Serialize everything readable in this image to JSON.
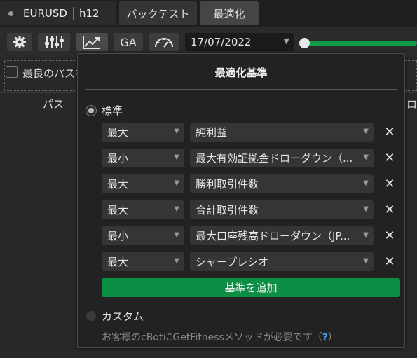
{
  "tabs": {
    "symbol": "EURUSD",
    "timeframe": "h12",
    "backtest": "バックテスト",
    "optimize": "最適化"
  },
  "toolbar": {
    "icons": [
      "gear-icon",
      "sliders-icon",
      "chart-line-icon",
      "ga-icon",
      "gauge-icon"
    ],
    "ga_label": "GA",
    "date": "17/07/2022",
    "progress": 1.0,
    "progress_color": "#0e9a44"
  },
  "background": {
    "checkbox_label": "最良のパスを",
    "col_pass": "パス",
    "col_right": "ロ"
  },
  "popup": {
    "title": "最適化基準",
    "standard_label": "標準",
    "standard_selected": true,
    "criteria": [
      {
        "direction": "最大",
        "metric": "純利益"
      },
      {
        "direction": "最小",
        "metric": "最大有効証拠金ドローダウン（..."
      },
      {
        "direction": "最大",
        "metric": "勝利取引件数"
      },
      {
        "direction": "最大",
        "metric": "合計取引件数"
      },
      {
        "direction": "最小",
        "metric": "最大口座残高ドローダウン（JP..."
      },
      {
        "direction": "最大",
        "metric": "シャープレシオ"
      }
    ],
    "add_button": "基準を追加",
    "custom_label": "カスタム",
    "custom_hint_prefix": "お客様のcBotにGetFitnessメソッドが必要です（",
    "custom_hint_link": "?",
    "custom_hint_suffix": "）",
    "accent_color": "#0b8f44"
  }
}
